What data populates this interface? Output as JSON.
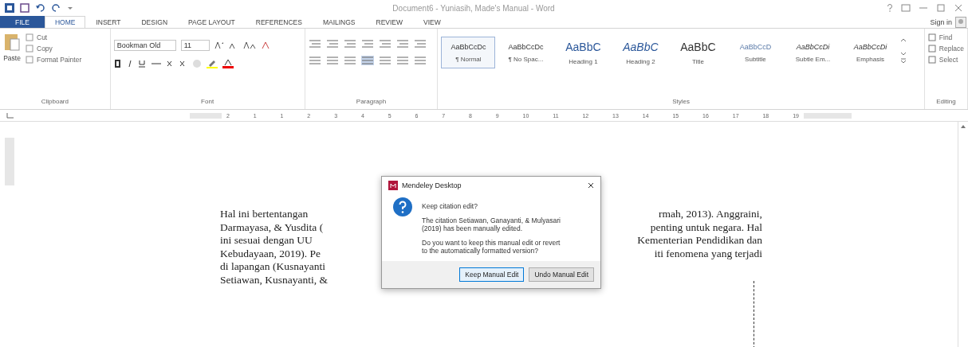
{
  "window": {
    "title": "Document6 - Yuniasih, Made's Manual - Word",
    "sign_in": "Sign in"
  },
  "tabs": [
    {
      "label": "FILE",
      "selected": false,
      "kind": "file"
    },
    {
      "label": "HOME",
      "selected": true,
      "kind": "tab"
    },
    {
      "label": "INSERT",
      "selected": false,
      "kind": "tab"
    },
    {
      "label": "DESIGN",
      "selected": false,
      "kind": "tab"
    },
    {
      "label": "PAGE LAYOUT",
      "selected": false,
      "kind": "tab"
    },
    {
      "label": "REFERENCES",
      "selected": false,
      "kind": "tab"
    },
    {
      "label": "MAILINGS",
      "selected": false,
      "kind": "tab"
    },
    {
      "label": "REVIEW",
      "selected": false,
      "kind": "tab"
    },
    {
      "label": "VIEW",
      "selected": false,
      "kind": "tab"
    }
  ],
  "clipboard": {
    "paste": "Paste",
    "cut": "Cut",
    "copy": "Copy",
    "format_painter": "Format Painter",
    "group_label": "Clipboard"
  },
  "font": {
    "font_name": "Bookman Old",
    "font_size": "11",
    "group_label": "Font"
  },
  "paragraph": {
    "group_label": "Paragraph"
  },
  "styles": {
    "group_label": "Styles",
    "items": [
      {
        "sample": "AaBbCcDc",
        "name": "¶ Normal",
        "selected": true
      },
      {
        "sample": "AaBbCcDc",
        "name": "¶ No Spac...",
        "selected": false
      },
      {
        "sample": "AaBbC",
        "name": "Heading 1",
        "selected": false
      },
      {
        "sample": "AaBbC",
        "name": "Heading 2",
        "selected": false
      },
      {
        "sample": "AaBbC",
        "name": "Title",
        "selected": false
      },
      {
        "sample": "AaBbCcD",
        "name": "Subtitle",
        "selected": false
      },
      {
        "sample": "AaBbCcDi",
        "name": "Subtle Em...",
        "selected": false
      },
      {
        "sample": "AaBbCcDi",
        "name": "Emphasis",
        "selected": false
      }
    ]
  },
  "editing": {
    "group_label": "Editing",
    "items": [
      "Find",
      "Replace",
      "Select"
    ]
  },
  "ruler": {
    "labels": [
      "2",
      "1",
      "1",
      "2",
      "3",
      "4",
      "5",
      "6",
      "7",
      "8",
      "9",
      "10",
      "11",
      "12",
      "13",
      "14",
      "15",
      "16",
      "17",
      "18",
      "19"
    ]
  },
  "document": {
    "lines": [
      {
        "left": "Hal ini bertentangan",
        "right": "rmah, 2013). Anggraini,"
      },
      {
        "left": "Darmayasa, & Yusdita (",
        "right": "penting untuk negara. Hal"
      },
      {
        "left": "ini sesuai dengan UU",
        "right": "Kementerian Pendidikan dan"
      },
      {
        "left": "Kebudayaan, 2019). Pe",
        "right": "iti fenomena yang terjadi"
      },
      {
        "left": "di lapangan (Kusnayanti"
      },
      {
        "left": "Setiawan, Kusnayanti, &"
      }
    ]
  },
  "dialog": {
    "title": "Mendeley Desktop",
    "heading": "Keep citation edit?",
    "message": "The citation Setiawan, Ganayanti, & Mulyasari (2019) has been manually edited.",
    "question": "Do you want to keep this manual edit or revert to the automatically formatted version?",
    "buttons": [
      {
        "label": "Keep Manual Edit",
        "selected": true
      },
      {
        "label": "Undo Manual Edit",
        "selected": false
      }
    ]
  }
}
